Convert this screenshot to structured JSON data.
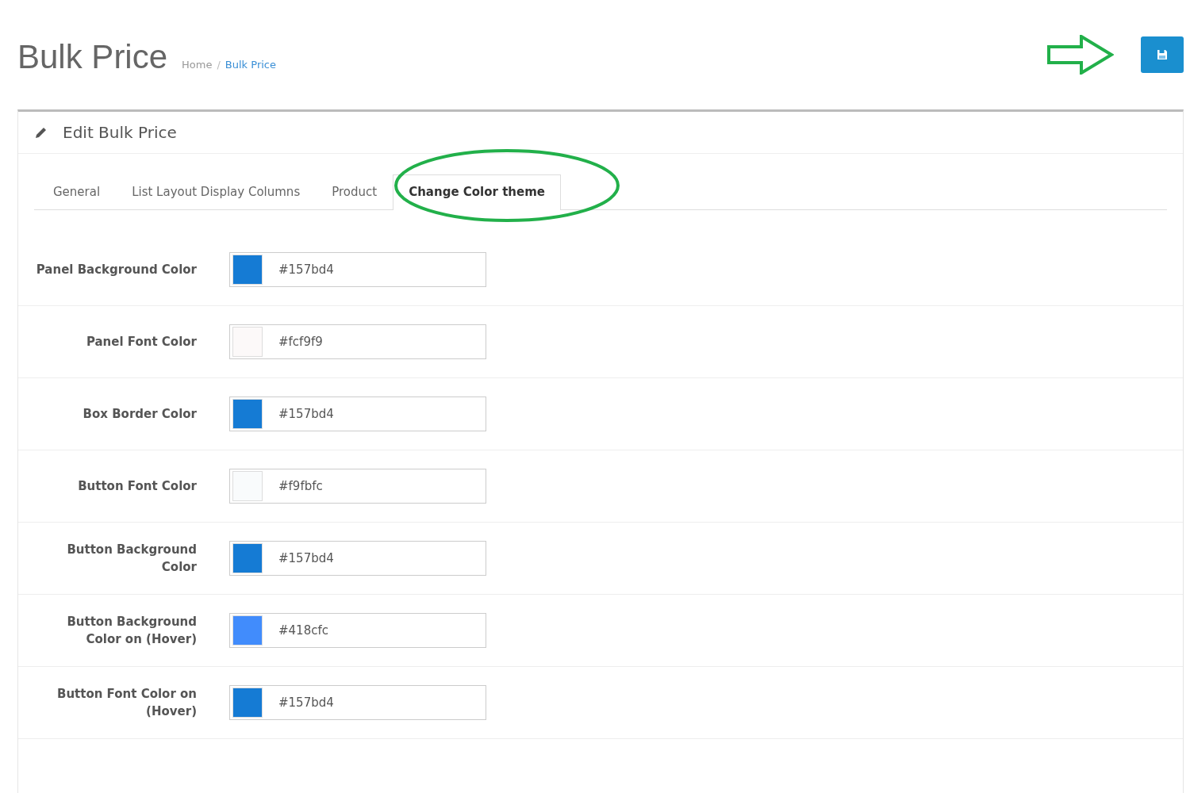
{
  "header": {
    "title": "Bulk Price",
    "separator": "/",
    "breadcrumb": [
      {
        "label": "Home",
        "selected": false
      },
      {
        "label": "Bulk Price",
        "selected": true
      }
    ]
  },
  "panel": {
    "heading": "Edit Bulk Price"
  },
  "tabs": [
    {
      "label": "General",
      "selected": false
    },
    {
      "label": "List Layout Display Columns",
      "selected": false
    },
    {
      "label": "Product",
      "selected": false
    },
    {
      "label": "Change Color theme",
      "selected": true
    }
  ],
  "fields": [
    {
      "label": "Panel Background Color",
      "value": "#157bd4",
      "color": "#157bd4"
    },
    {
      "label": "Panel Font Color",
      "value": "#fcf9f9",
      "color": "#fcf9f9"
    },
    {
      "label": "Box Border Color",
      "value": "#157bd4",
      "color": "#157bd4"
    },
    {
      "label": "Button Font Color",
      "value": "#f9fbfc",
      "color": "#f9fbfc"
    },
    {
      "label": "Button Background Color",
      "value": "#157bd4",
      "color": "#157bd4"
    },
    {
      "label": "Button Background Color on (Hover)",
      "value": "#418cfc",
      "color": "#418cfc"
    },
    {
      "label": "Button Font Color on (Hover)",
      "value": "#157bd4",
      "color": "#157bd4"
    }
  ]
}
